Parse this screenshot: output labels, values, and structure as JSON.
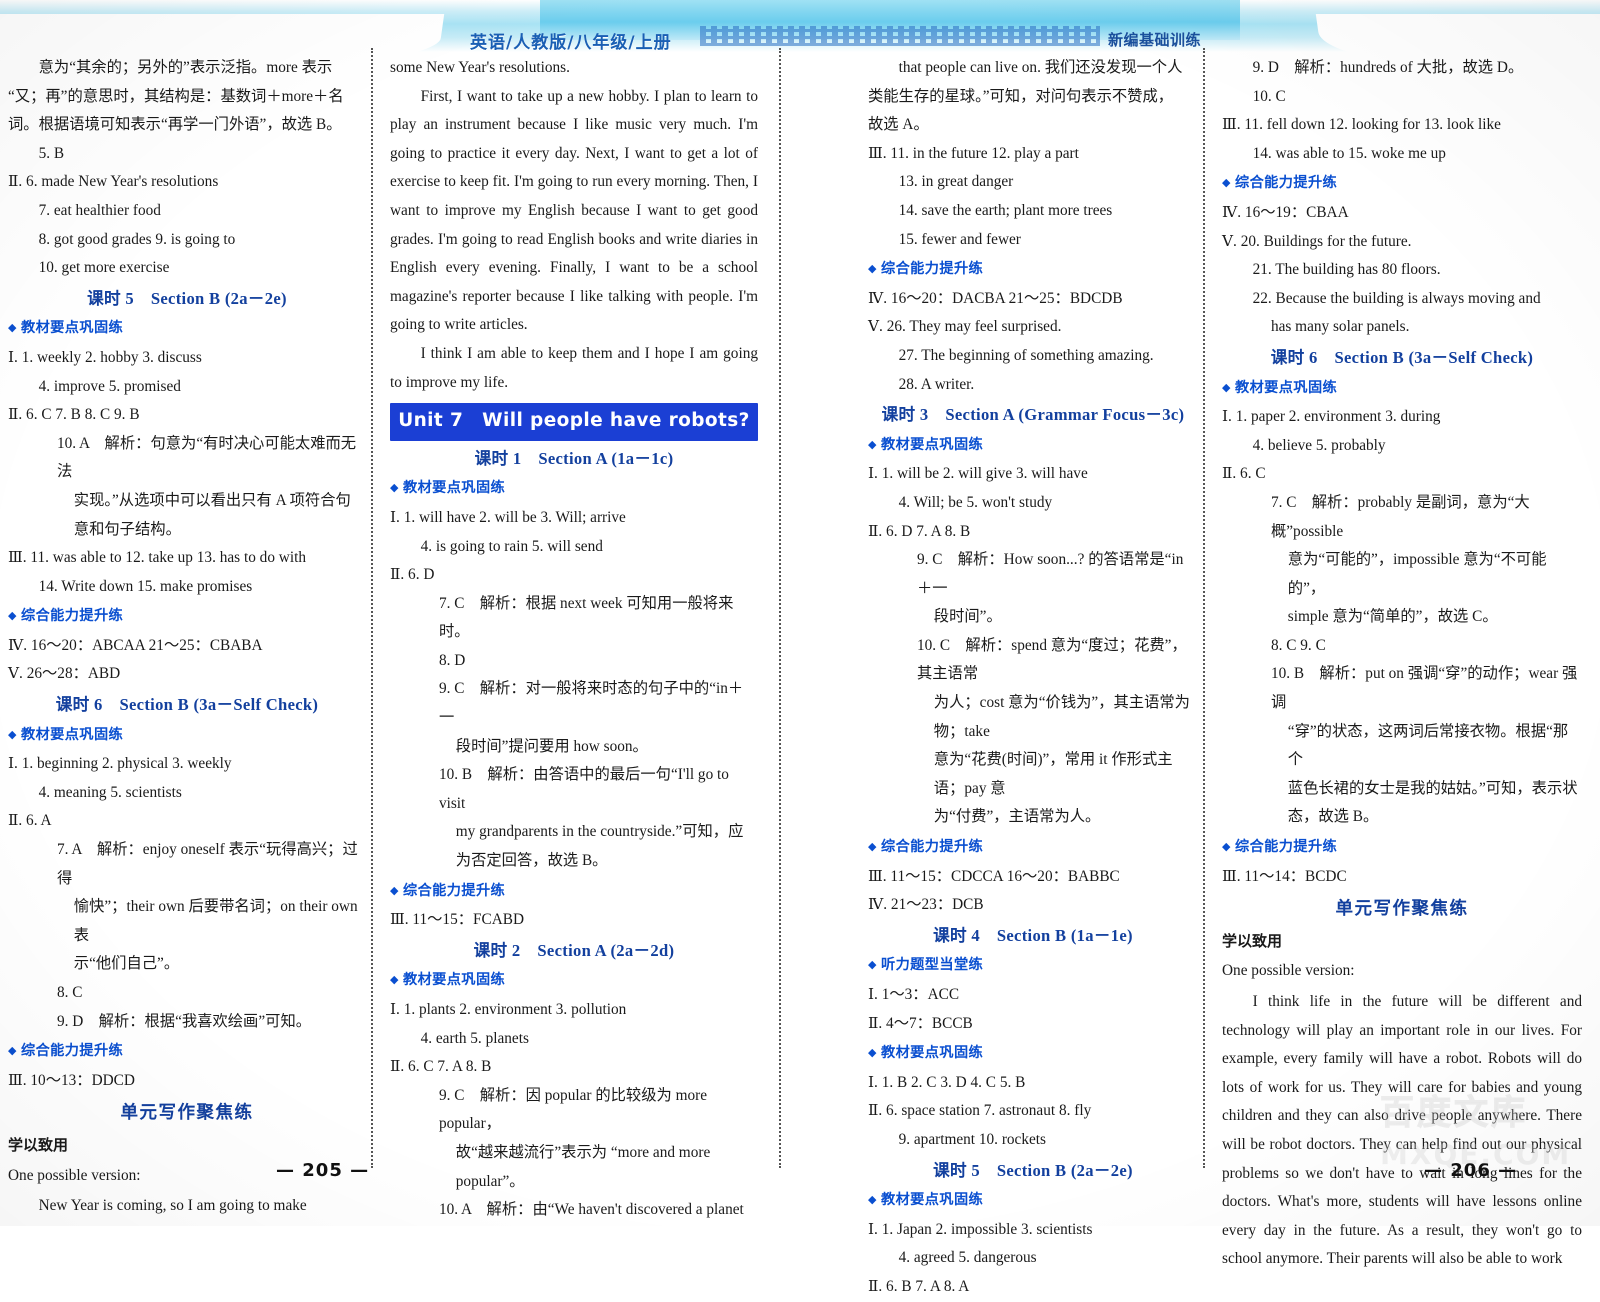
{
  "header": {
    "title": "英语/人教版/八年级/上册",
    "brand": "新编基础训练"
  },
  "labels": {
    "jiaocai": "教材要点巩固练",
    "zonghe": "综合能力提升练",
    "tingli": "听力题型当堂练",
    "danyuan": "单元写作聚焦练",
    "xueyi": "学以致用",
    "onepossible": "One possible version:"
  },
  "page_numbers": {
    "left": "— 205 —",
    "right": "— 206 —"
  },
  "watermark": {
    "line1": "百度文库",
    "line2": "MXQE.COM"
  },
  "column1": {
    "c1_l1": "意为“其余的；另外的”表示泛指。more 表示",
    "c1_l2": "“又；再”的意思时，其结构是：基数词＋more＋名",
    "c1_l3": "词。根据语境可知表示“再学一门外语”，故选 B。",
    "c1_l4": "5. B",
    "c1_l5": "Ⅱ. 6. made New Year's resolutions",
    "c1_l6": "7. eat healthier food",
    "c1_l7": "8. got good grades   9. is going to",
    "c1_l8": "10. get more exercise",
    "ks5_title": "课时 5　Section B (2a－2e)",
    "c1_l9": "Ⅰ. 1. weekly   2. hobby   3. discuss",
    "c1_l10": "4. improve   5. promised",
    "c1_l11": "Ⅱ. 6. C   7. B   8. C   9. B",
    "c1_l12": "10. A　解析：句意为“有时决心可能太难而无法",
    "c1_l13": "实现。”从选项中可以看出只有 A 项符合句",
    "c1_l14": "意和句子结构。",
    "c1_l15": "Ⅲ. 11. was able to   12. take up   13. has to do with",
    "c1_l16": "14. Write down   15. make promises",
    "c1_l17": "Ⅳ. 16～20：ABCAA   21～25：CBABA",
    "c1_l18": "Ⅴ. 26～28：ABD",
    "ks6_title": "课时 6　Section B (3a－Self Check)",
    "c1_l19": "Ⅰ. 1. beginning   2. physical   3. weekly",
    "c1_l20": "4. meaning   5. scientists",
    "c1_l21": "Ⅱ. 6. A",
    "c1_l22": "7. A　解析：enjoy oneself 表示“玩得高兴；过得",
    "c1_l23": "愉快”；their own 后要带名词；on their own 表",
    "c1_l24": "示“他们自己”。",
    "c1_l25": "8. C",
    "c1_l26": "9. D　解析：根据“我喜欢绘画”可知。",
    "c1_l27": "Ⅲ. 10～13：DDCD",
    "c1_l28": "New Year is coming, so I am going to make"
  },
  "column2": {
    "c2_l1": "some New Year's resolutions.",
    "c2_p1": "First, I want to take up a new hobby. I plan to learn to play an instrument because I like music very much. I'm going to practice it every day. Next, I want to get a lot of exercise to keep fit. I'm going to run every morning. Then, I want to improve my English because I want to get good grades. I'm going to read English books and write diaries in English every evening. Finally, I want to be a school magazine's reporter because I like talking with people. I'm going to write articles.",
    "c2_p2": "I think I am able to keep them and I hope I am going to improve my life.",
    "unit7_banner": "Unit 7　Will people have robots?",
    "ks1_title": "课时 1　Section A (1a－1c)",
    "c2_l2": "Ⅰ. 1. will have   2. will be   3. Will; arrive",
    "c2_l3": "4. is going to rain   5. will send",
    "c2_l4": "Ⅱ. 6. D",
    "c2_l5": "7. C　解析：根据 next week 可知用一般将来时。",
    "c2_l6": "8. D",
    "c2_l7": "9. C　解析：对一般将来时态的句子中的“in＋一",
    "c2_l8": "段时间”提问要用 how soon。",
    "c2_l9": "10. B　解析：由答语中的最后一句“I'll go to visit",
    "c2_l10": "my grandparents in the countryside.”可知，应",
    "c2_l11": "为否定回答，故选 B。",
    "c2_l12": "Ⅲ. 11～15：FCABD",
    "ks2_title": "课时 2　Section A (2a－2d)",
    "c2_l13": "Ⅰ. 1. plants   2. environment   3. pollution",
    "c2_l14": "4. earth   5. planets",
    "c2_l15": "Ⅱ. 6. C   7. A   8. B",
    "c2_l16": "9. C　解析：因 popular 的比较级为 more popular，",
    "c2_l17": "故“越来越流行”表示为 “more and more",
    "c2_l18": "popular”。",
    "c2_l19": "10. A　解析：由“We haven't discovered a planet"
  },
  "column3": {
    "c3_l1": "that people can live on. 我们还没发现一个人",
    "c3_l2": "类能生存的星球。”可知，对问句表示不赞成，",
    "c3_l3": "故选 A。",
    "c3_l4": "Ⅲ. 11. in the future   12. play a part",
    "c3_l5": "13. in great danger",
    "c3_l6": "14. save the earth; plant more trees",
    "c3_l7": "15. fewer and fewer",
    "c3_l8": "Ⅳ. 16～20：DACBA   21～25：BDCDB",
    "c3_l9": "Ⅴ. 26. They may feel surprised.",
    "c3_l10": "27. The beginning of something amazing.",
    "c3_l11": "28. A writer.",
    "ks3_title": "课时 3　Section A (Grammar Focus－3c)",
    "c3_l12": "Ⅰ. 1. will be   2. will give   3. will have",
    "c3_l13": "4. Will; be   5. won't study",
    "c3_l14": "Ⅱ. 6. D   7. A   8. B",
    "c3_l15": "9. C　解析：How soon...? 的答语常是“in＋一",
    "c3_l16": "段时间”。",
    "c3_l17": "10. C　解析：spend 意为“度过；花费”，其主语常",
    "c3_l18": "为人；cost 意为“价钱为”，其主语常为物；take",
    "c3_l19": "意为“花费(时间)”，常用 it 作形式主语；pay 意",
    "c3_l20": "为“付费”，主语常为人。",
    "c3_l21": "Ⅲ. 11～15：CDCCA   16～20：BABBC",
    "c3_l22": "Ⅳ. 21～23：DCB",
    "ks4_title": "课时 4　Section B (1a－1e)",
    "c3_l23": "Ⅰ. 1～3：ACC",
    "c3_l24": "Ⅱ. 4～7：BCCB",
    "c3_l25": "Ⅰ. 1. B   2. C   3. D   4. C   5. B",
    "c3_l26": "Ⅱ. 6. space station   7. astronaut   8. fly",
    "c3_l27": "9. apartment   10. rockets",
    "ks5_title": "课时 5　Section B (2a－2e)",
    "c3_l28": "Ⅰ. 1. Japan   2. impossible   3. scientists",
    "c3_l29": "4. agreed   5. dangerous",
    "c3_l30": "Ⅱ. 6. B   7. A   8. A"
  },
  "column4": {
    "c4_l1": "9. D　解析：hundreds of 大批，故选 D。",
    "c4_l2": "10. C",
    "c4_l3": "Ⅲ. 11. fell down   12. looking for   13. look like",
    "c4_l4": "14. was able to   15. woke me up",
    "c4_l5": "Ⅳ. 16～19：CBAA",
    "c4_l6": "Ⅴ. 20. Buildings for the future.",
    "c4_l7": "21. The building has 80 floors.",
    "c4_l8": "22. Because the building is always moving and",
    "c4_l9": "has many solar panels.",
    "ks6_title": "课时 6　Section B (3a－Self Check)",
    "c4_l10": "Ⅰ. 1. paper   2. environment   3. during",
    "c4_l11": "4. believe   5. probably",
    "c4_l12": "Ⅱ. 6. C",
    "c4_l13": "7. C　解析：probably 是副词，意为“大概”possible",
    "c4_l14": "意为“可能的”，impossible 意为“不可能的”，",
    "c4_l15": "simple 意为“简单的”，故选 C。",
    "c4_l16": "8. C   9. C",
    "c4_l17": "10. B　解析：put on 强调“穿”的动作；wear 强调",
    "c4_l18": "“穿”的状态，这两词后常接衣物。根据“那个",
    "c4_l19": "蓝色长裙的女士是我的姑姑。”可知，表示状",
    "c4_l20": "态，故选 B。",
    "c4_l21": "Ⅲ. 11～14：BCDC",
    "c4_p1": "I think life in the future will be different and technology will play an important role in our lives. For example, every family will have a robot. Robots will do lots of work for us. They will care for babies and young children and they can also drive people anywhere. There will be robot doctors. They can help find out our physical problems so we don't have to wait in long lines for the doctors. What's more, students will have lessons online every day in the future. As a result, they won't go to school anymore. Their parents will also be able to work"
  }
}
